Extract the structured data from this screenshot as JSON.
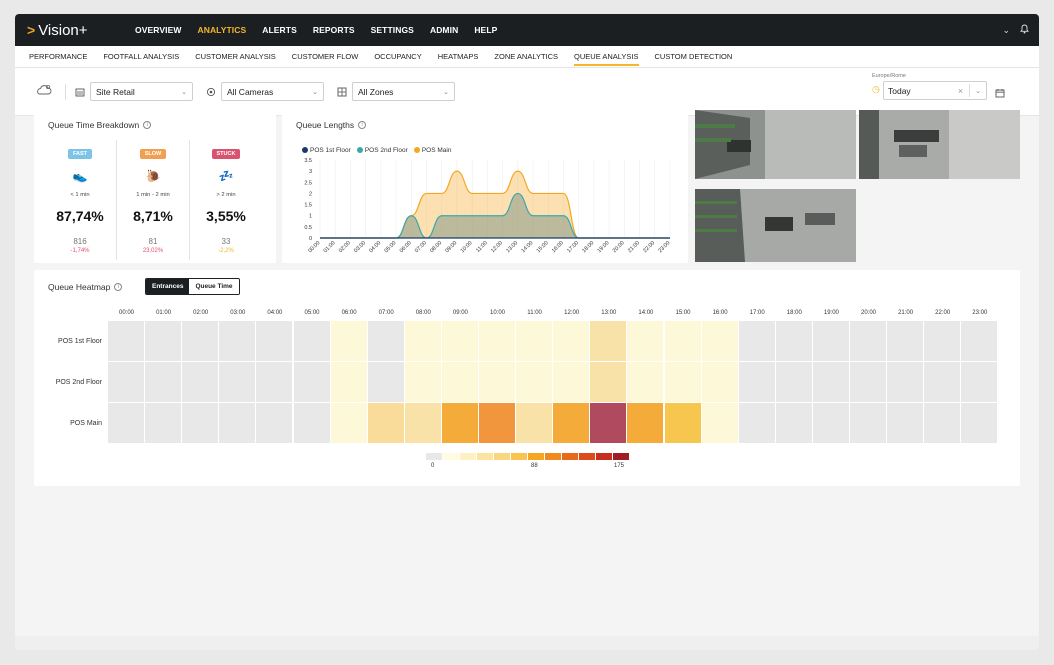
{
  "app": {
    "brand": "Vision+"
  },
  "main_menu": [
    "OVERVIEW",
    "ANALYTICS",
    "ALERTS",
    "REPORTS",
    "SETTINGS",
    "ADMIN",
    "HELP"
  ],
  "main_menu_active": "ANALYTICS",
  "sub_menu": [
    "PERFORMANCE",
    "FOOTFALL ANALYSIS",
    "CUSTOMER ANALYSIS",
    "CUSTOMER FLOW",
    "OCCUPANCY",
    "HEATMAPS",
    "ZONE ANALYTICS",
    "QUEUE ANALYSIS",
    "CUSTOM DETECTION"
  ],
  "sub_menu_active": "QUEUE ANALYSIS",
  "filters": {
    "site": "Site Retail",
    "cameras": "All Cameras",
    "zones": "All Zones",
    "timezone": "Europe/Rome",
    "date": "Today"
  },
  "queue_breakdown": {
    "title": "Queue Time Breakdown",
    "columns": [
      {
        "badge": "FAST",
        "badge_color": "#7cc3e6",
        "icon": "running-shoe-icon",
        "glyph": "👟",
        "range": "< 1 min",
        "percent": "87,74%",
        "count": "816",
        "delta": "-1,74%",
        "delta_color": "#e0506e"
      },
      {
        "badge": "SLOW",
        "badge_color": "#f0a050",
        "icon": "snail-icon",
        "glyph": "🐌",
        "range": "1 min - 2 min",
        "percent": "8,71%",
        "count": "81",
        "delta": "23,02%",
        "delta_color": "#e0506e"
      },
      {
        "badge": "STUCK",
        "badge_color": "#d9536e",
        "icon": "sleep-icon",
        "glyph": "💤",
        "range": "> 2 min",
        "percent": "3,55%",
        "count": "33",
        "delta": "-2,2%",
        "delta_color": "#f0b429"
      }
    ]
  },
  "queue_lengths": {
    "title": "Queue Lengths"
  },
  "chart_data": {
    "type": "area",
    "title": "Queue Lengths",
    "x": [
      "00:00",
      "01:00",
      "02:00",
      "03:00",
      "04:00",
      "05:00",
      "06:00",
      "07:00",
      "08:00",
      "09:00",
      "10:00",
      "11:00",
      "12:00",
      "13:00",
      "14:00",
      "15:00",
      "16:00",
      "17:00",
      "18:00",
      "19:00",
      "20:00",
      "21:00",
      "22:00",
      "23:00"
    ],
    "ylim": [
      0,
      3.5
    ],
    "yticks": [
      0,
      0.5,
      1,
      1.5,
      2,
      2.5,
      3,
      3.5
    ],
    "series": [
      {
        "name": "POS 1st Floor",
        "color": "#1a3a6b",
        "values": [
          0,
          0,
          0,
          0,
          0,
          0,
          0,
          0,
          0,
          0,
          0,
          0,
          0,
          0,
          0,
          0,
          0,
          0,
          0,
          0,
          0,
          0,
          0,
          0
        ]
      },
      {
        "name": "POS 2nd Floor",
        "color": "#3aa8a8",
        "values": [
          0,
          0,
          0,
          0,
          0,
          0,
          1,
          0,
          1,
          1,
          1,
          1,
          1,
          2,
          1,
          1,
          1,
          0,
          0,
          0,
          0,
          0,
          0,
          0
        ]
      },
      {
        "name": "POS Main",
        "color": "#f5a623",
        "values": [
          0,
          0,
          0,
          0,
          0,
          0,
          1,
          2,
          2,
          3,
          2,
          2,
          2,
          3,
          2,
          2,
          2,
          0,
          0,
          0,
          0,
          0,
          0,
          0
        ]
      }
    ]
  },
  "heatmap": {
    "title": "Queue Heatmap",
    "toggle": [
      "Entrances",
      "Queue Time"
    ],
    "toggle_active": "Entrances",
    "hours": [
      "00:00",
      "01:00",
      "02:00",
      "03:00",
      "04:00",
      "05:00",
      "06:00",
      "07:00",
      "08:00",
      "09:00",
      "10:00",
      "11:00",
      "12:00",
      "13:00",
      "14:00",
      "15:00",
      "16:00",
      "17:00",
      "18:00",
      "19:00",
      "20:00",
      "21:00",
      "22:00",
      "23:00"
    ],
    "rows": [
      {
        "label": "POS 1st Floor",
        "values": [
          0,
          0,
          0,
          0,
          0,
          0,
          3,
          0,
          4,
          4,
          4,
          3,
          3,
          20,
          4,
          4,
          4,
          0,
          0,
          0,
          0,
          0,
          0,
          0
        ]
      },
      {
        "label": "POS 2nd Floor",
        "values": [
          0,
          0,
          0,
          0,
          0,
          0,
          3,
          0,
          3,
          3,
          3,
          3,
          3,
          20,
          3,
          3,
          3,
          0,
          0,
          0,
          0,
          0,
          0,
          0
        ]
      },
      {
        "label": "POS Main",
        "values": [
          0,
          0,
          0,
          0,
          0,
          0,
          4,
          30,
          20,
          90,
          100,
          25,
          80,
          175,
          90,
          60,
          5,
          0,
          0,
          0,
          0,
          0,
          0,
          0
        ]
      }
    ],
    "scale": {
      "min_label": "0",
      "mid_label": "88",
      "max_label": "175",
      "colors": [
        "#e8e8e8",
        "#fffbe0",
        "#fdf1c4",
        "#fce4a0",
        "#fbd680",
        "#f9c550",
        "#f5a623",
        "#f08a1a",
        "#e86a18",
        "#dd4b1a",
        "#c73020",
        "#a01c28"
      ]
    }
  }
}
